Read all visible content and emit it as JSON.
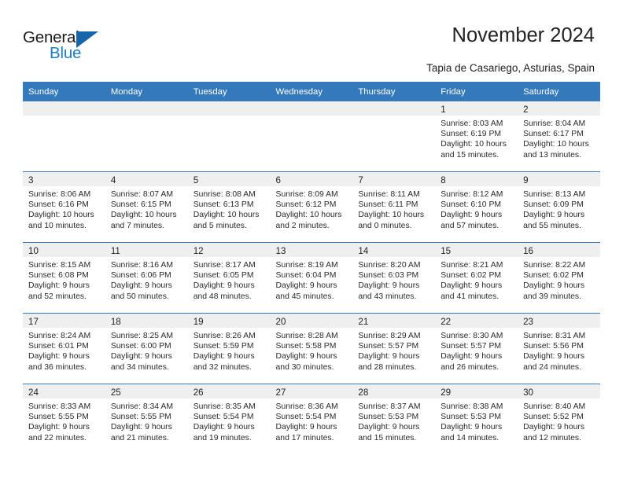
{
  "brand": {
    "name_part1": "General",
    "name_part2": "Blue",
    "accent_color": "#1d7cc4",
    "triangle_color": "#1565a8"
  },
  "header": {
    "title": "November 2024",
    "subtitle": "Tapia de Casariego, Asturias, Spain"
  },
  "theme": {
    "header_blue": "#3479bb",
    "daynum_strip": "#efefef"
  },
  "weekday_headers": [
    "Sunday",
    "Monday",
    "Tuesday",
    "Wednesday",
    "Thursday",
    "Friday",
    "Saturday"
  ],
  "weeks": [
    [
      {
        "day": "",
        "sunrise": "",
        "sunset": "",
        "daylight": ""
      },
      {
        "day": "",
        "sunrise": "",
        "sunset": "",
        "daylight": ""
      },
      {
        "day": "",
        "sunrise": "",
        "sunset": "",
        "daylight": ""
      },
      {
        "day": "",
        "sunrise": "",
        "sunset": "",
        "daylight": ""
      },
      {
        "day": "",
        "sunrise": "",
        "sunset": "",
        "daylight": ""
      },
      {
        "day": "1",
        "sunrise": "Sunrise: 8:03 AM",
        "sunset": "Sunset: 6:19 PM",
        "daylight": "Daylight: 10 hours and 15 minutes."
      },
      {
        "day": "2",
        "sunrise": "Sunrise: 8:04 AM",
        "sunset": "Sunset: 6:17 PM",
        "daylight": "Daylight: 10 hours and 13 minutes."
      }
    ],
    [
      {
        "day": "3",
        "sunrise": "Sunrise: 8:06 AM",
        "sunset": "Sunset: 6:16 PM",
        "daylight": "Daylight: 10 hours and 10 minutes."
      },
      {
        "day": "4",
        "sunrise": "Sunrise: 8:07 AM",
        "sunset": "Sunset: 6:15 PM",
        "daylight": "Daylight: 10 hours and 7 minutes."
      },
      {
        "day": "5",
        "sunrise": "Sunrise: 8:08 AM",
        "sunset": "Sunset: 6:13 PM",
        "daylight": "Daylight: 10 hours and 5 minutes."
      },
      {
        "day": "6",
        "sunrise": "Sunrise: 8:09 AM",
        "sunset": "Sunset: 6:12 PM",
        "daylight": "Daylight: 10 hours and 2 minutes."
      },
      {
        "day": "7",
        "sunrise": "Sunrise: 8:11 AM",
        "sunset": "Sunset: 6:11 PM",
        "daylight": "Daylight: 10 hours and 0 minutes."
      },
      {
        "day": "8",
        "sunrise": "Sunrise: 8:12 AM",
        "sunset": "Sunset: 6:10 PM",
        "daylight": "Daylight: 9 hours and 57 minutes."
      },
      {
        "day": "9",
        "sunrise": "Sunrise: 8:13 AM",
        "sunset": "Sunset: 6:09 PM",
        "daylight": "Daylight: 9 hours and 55 minutes."
      }
    ],
    [
      {
        "day": "10",
        "sunrise": "Sunrise: 8:15 AM",
        "sunset": "Sunset: 6:08 PM",
        "daylight": "Daylight: 9 hours and 52 minutes."
      },
      {
        "day": "11",
        "sunrise": "Sunrise: 8:16 AM",
        "sunset": "Sunset: 6:06 PM",
        "daylight": "Daylight: 9 hours and 50 minutes."
      },
      {
        "day": "12",
        "sunrise": "Sunrise: 8:17 AM",
        "sunset": "Sunset: 6:05 PM",
        "daylight": "Daylight: 9 hours and 48 minutes."
      },
      {
        "day": "13",
        "sunrise": "Sunrise: 8:19 AM",
        "sunset": "Sunset: 6:04 PM",
        "daylight": "Daylight: 9 hours and 45 minutes."
      },
      {
        "day": "14",
        "sunrise": "Sunrise: 8:20 AM",
        "sunset": "Sunset: 6:03 PM",
        "daylight": "Daylight: 9 hours and 43 minutes."
      },
      {
        "day": "15",
        "sunrise": "Sunrise: 8:21 AM",
        "sunset": "Sunset: 6:02 PM",
        "daylight": "Daylight: 9 hours and 41 minutes."
      },
      {
        "day": "16",
        "sunrise": "Sunrise: 8:22 AM",
        "sunset": "Sunset: 6:02 PM",
        "daylight": "Daylight: 9 hours and 39 minutes."
      }
    ],
    [
      {
        "day": "17",
        "sunrise": "Sunrise: 8:24 AM",
        "sunset": "Sunset: 6:01 PM",
        "daylight": "Daylight: 9 hours and 36 minutes."
      },
      {
        "day": "18",
        "sunrise": "Sunrise: 8:25 AM",
        "sunset": "Sunset: 6:00 PM",
        "daylight": "Daylight: 9 hours and 34 minutes."
      },
      {
        "day": "19",
        "sunrise": "Sunrise: 8:26 AM",
        "sunset": "Sunset: 5:59 PM",
        "daylight": "Daylight: 9 hours and 32 minutes."
      },
      {
        "day": "20",
        "sunrise": "Sunrise: 8:28 AM",
        "sunset": "Sunset: 5:58 PM",
        "daylight": "Daylight: 9 hours and 30 minutes."
      },
      {
        "day": "21",
        "sunrise": "Sunrise: 8:29 AM",
        "sunset": "Sunset: 5:57 PM",
        "daylight": "Daylight: 9 hours and 28 minutes."
      },
      {
        "day": "22",
        "sunrise": "Sunrise: 8:30 AM",
        "sunset": "Sunset: 5:57 PM",
        "daylight": "Daylight: 9 hours and 26 minutes."
      },
      {
        "day": "23",
        "sunrise": "Sunrise: 8:31 AM",
        "sunset": "Sunset: 5:56 PM",
        "daylight": "Daylight: 9 hours and 24 minutes."
      }
    ],
    [
      {
        "day": "24",
        "sunrise": "Sunrise: 8:33 AM",
        "sunset": "Sunset: 5:55 PM",
        "daylight": "Daylight: 9 hours and 22 minutes."
      },
      {
        "day": "25",
        "sunrise": "Sunrise: 8:34 AM",
        "sunset": "Sunset: 5:55 PM",
        "daylight": "Daylight: 9 hours and 21 minutes."
      },
      {
        "day": "26",
        "sunrise": "Sunrise: 8:35 AM",
        "sunset": "Sunset: 5:54 PM",
        "daylight": "Daylight: 9 hours and 19 minutes."
      },
      {
        "day": "27",
        "sunrise": "Sunrise: 8:36 AM",
        "sunset": "Sunset: 5:54 PM",
        "daylight": "Daylight: 9 hours and 17 minutes."
      },
      {
        "day": "28",
        "sunrise": "Sunrise: 8:37 AM",
        "sunset": "Sunset: 5:53 PM",
        "daylight": "Daylight: 9 hours and 15 minutes."
      },
      {
        "day": "29",
        "sunrise": "Sunrise: 8:38 AM",
        "sunset": "Sunset: 5:53 PM",
        "daylight": "Daylight: 9 hours and 14 minutes."
      },
      {
        "day": "30",
        "sunrise": "Sunrise: 8:40 AM",
        "sunset": "Sunset: 5:52 PM",
        "daylight": "Daylight: 9 hours and 12 minutes."
      }
    ]
  ]
}
